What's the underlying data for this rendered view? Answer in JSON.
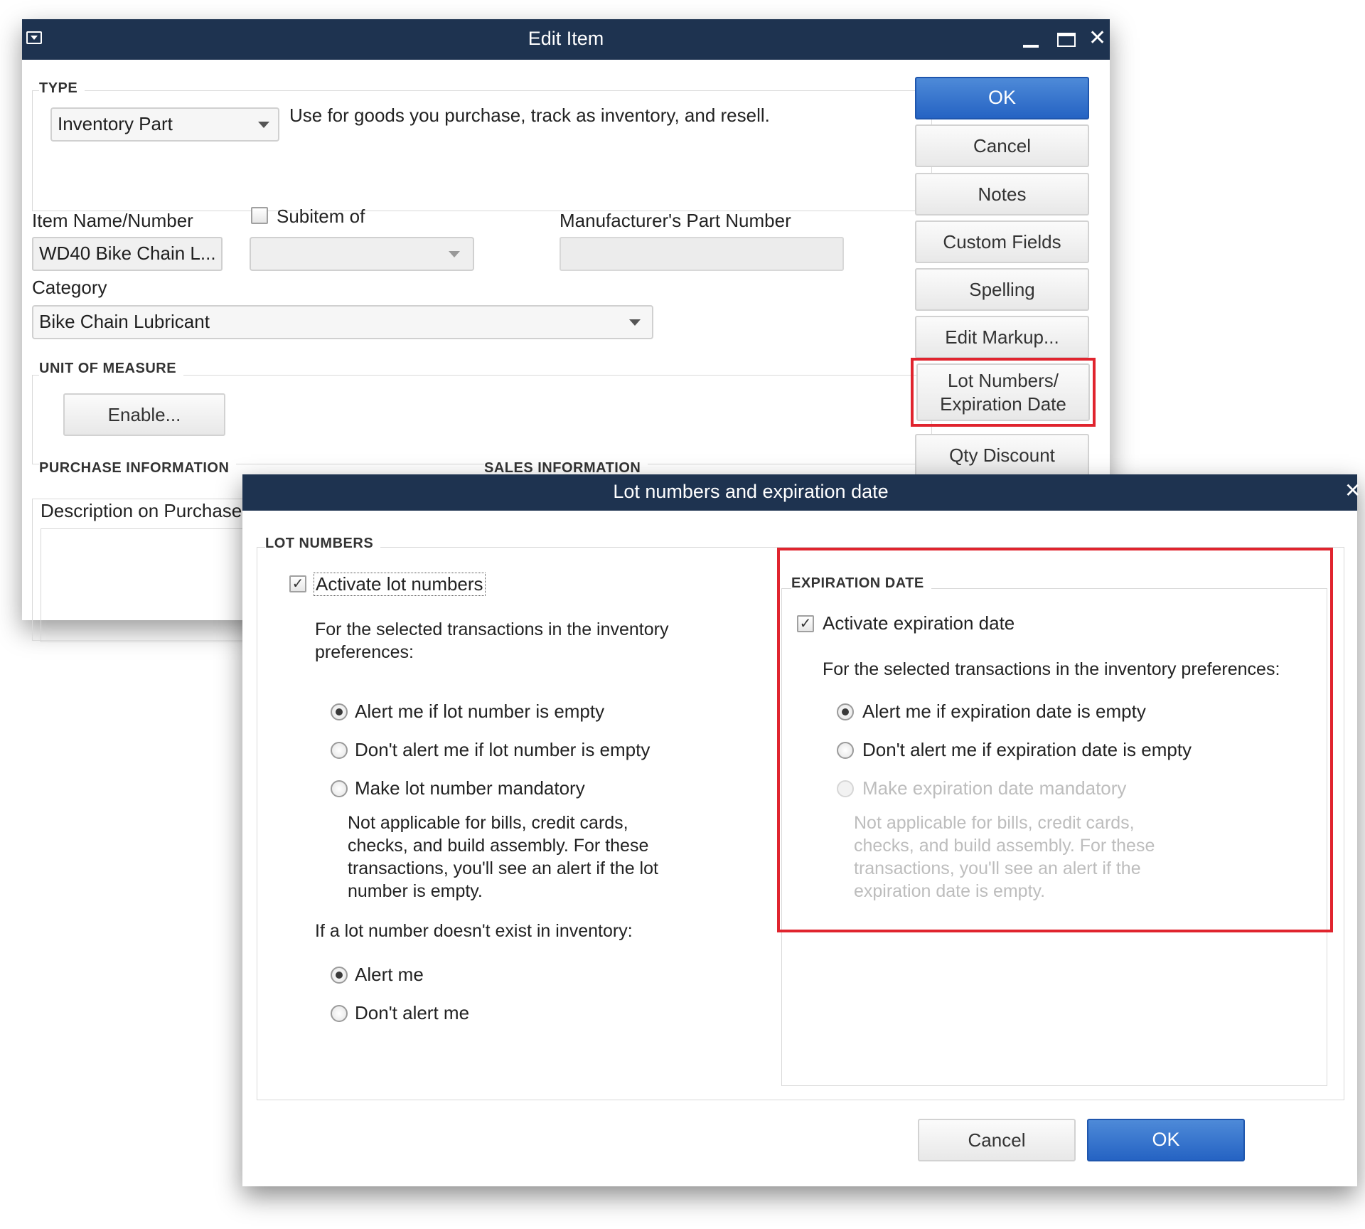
{
  "edit_item": {
    "title": "Edit Item",
    "type_section": {
      "label": "TYPE",
      "selected": "Inventory Part",
      "description": "Use for goods you purchase, track as inventory, and resell."
    },
    "item_name_label": "Item Name/Number",
    "item_name_value": "WD40 Bike Chain L...",
    "subitem_label": "Subitem of",
    "mpn_label": "Manufacturer's Part Number",
    "category_label": "Category",
    "category_value": "Bike Chain Lubricant",
    "uom_label": "UNIT OF MEASURE",
    "enable_button": "Enable...",
    "purchase_info_label": "PURCHASE INFORMATION",
    "sales_info_label": "SALES INFORMATION",
    "desc_purchases_label": "Description on Purchase",
    "buttons": {
      "ok": "OK",
      "cancel": "Cancel",
      "notes": "Notes",
      "custom_fields": "Custom Fields",
      "spelling": "Spelling",
      "edit_markup": "Edit Markup...",
      "lot_numbers_line1": "Lot Numbers/",
      "lot_numbers_line2": "Expiration Date",
      "qty_discount": "Qty Discount"
    }
  },
  "lot_dialog": {
    "title": "Lot numbers and expiration date",
    "lot_numbers": {
      "label": "LOT NUMBERS",
      "activate": "Activate lot numbers",
      "activate_checked": true,
      "instructions_line1": "For the selected transactions in the inventory",
      "instructions_line2": "preferences:",
      "options": [
        {
          "label": "Alert me if lot number is empty",
          "selected": true
        },
        {
          "label": "Don't alert me if lot number is empty",
          "selected": false
        },
        {
          "label": "Make lot number mandatory",
          "selected": false
        }
      ],
      "note_lines": [
        "Not applicable for bills, credit cards,",
        "checks, and build assembly. For these",
        "transactions, you'll see an alert if the lot",
        "number is empty."
      ],
      "not_exist_label": "If a lot number doesn't exist in inventory:",
      "not_exist_options": [
        {
          "label": "Alert me",
          "selected": true
        },
        {
          "label": "Don't alert me",
          "selected": false
        }
      ]
    },
    "expiration_date": {
      "label": "EXPIRATION DATE",
      "activate": "Activate expiration date",
      "activate_checked": true,
      "instructions": "For the selected transactions in the inventory preferences:",
      "options": [
        {
          "label": "Alert me if expiration date is empty",
          "selected": true
        },
        {
          "label": "Don't alert me if expiration date is empty",
          "selected": false
        },
        {
          "label": "Make expiration date mandatory",
          "selected": false,
          "disabled": true
        }
      ],
      "note_lines": [
        "Not applicable for bills, credit cards,",
        "checks, and build assembly. For these",
        "transactions, you'll see an alert if the",
        "expiration date is empty."
      ]
    },
    "cancel": "Cancel",
    "ok": "OK"
  },
  "colors": {
    "titlebar": "#1e3350",
    "primary_button": "#2f6fd0",
    "highlight": "#e0242e"
  },
  "icons": {
    "system_menu": "system-menu-icon",
    "minimize": "minimize-icon",
    "maximize": "maximize-icon",
    "close": "close-icon"
  }
}
